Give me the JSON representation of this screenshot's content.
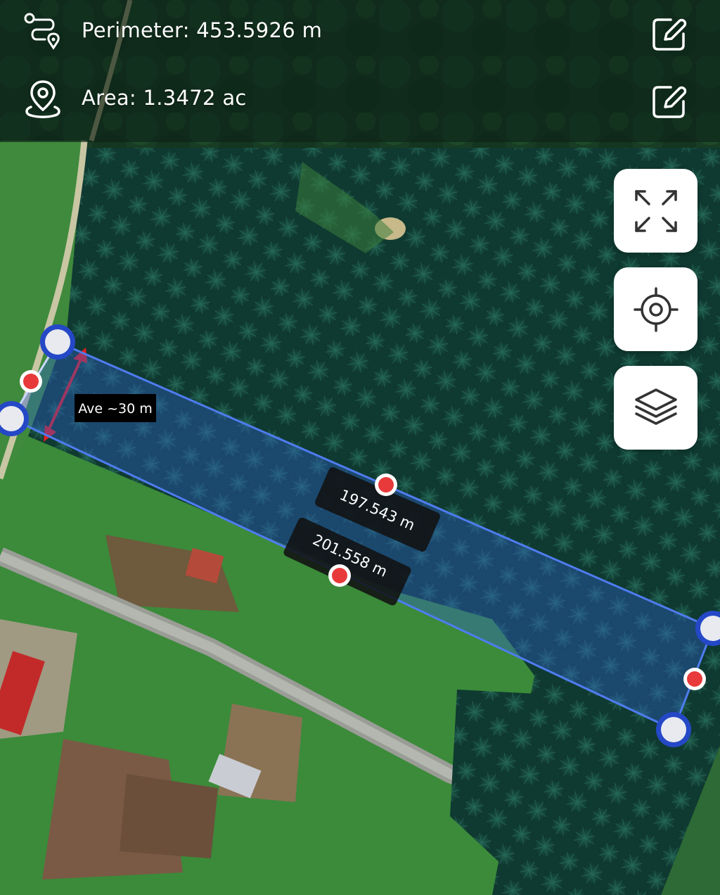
{
  "header": {
    "perimeter_text": "Perimeter: 453.5926 m",
    "area_text": "Area: 1.3472 ac",
    "perimeter_icon": "route-icon",
    "area_icon": "location-pin-icon",
    "edit_icon": "edit-pencil-icon"
  },
  "controls": {
    "fullscreen_icon": "expand-arrows-icon",
    "locate_icon": "crosshair-target-icon",
    "layers_icon": "layers-stack-icon"
  },
  "measurements": {
    "width_note": "Ave ~30 m",
    "top_edge_length": "197.543 m",
    "bottom_edge_length": "201.558 m"
  },
  "colors": {
    "polygon_fill": "#2f5fd0",
    "polygon_stroke": "#4f7cf0",
    "vertex_ring": "#2548c7",
    "midpoint_fill": "#e83a3a",
    "dimension_arrow": "#e02020",
    "label_bg": "#111111",
    "header_overlay": "#0c2016",
    "button_bg": "#ffffff"
  }
}
